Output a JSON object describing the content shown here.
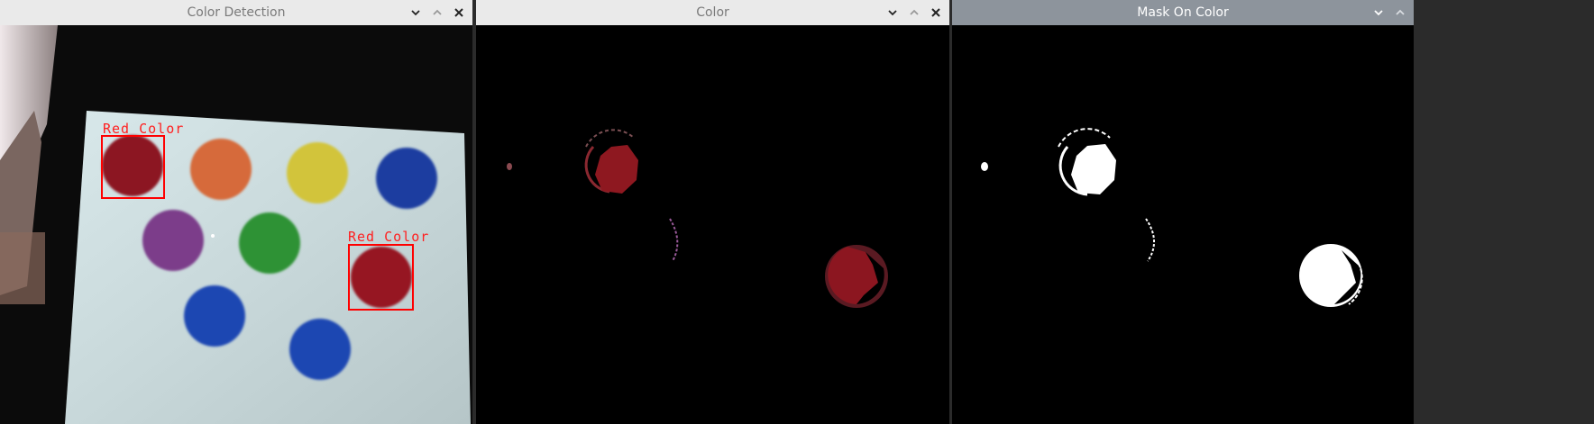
{
  "windows": [
    {
      "title": "Color Detection"
    },
    {
      "title": "Color"
    },
    {
      "title": "Mask On Color"
    }
  ],
  "detection": {
    "labels": [
      "Red Color",
      "Red Color"
    ]
  },
  "icons": {
    "minimize": "chevron-down-icon",
    "maximize": "chevron-up-icon",
    "close": "close-icon"
  },
  "colors": {
    "box": "#ff0000",
    "titlebar_light": "#eaeaea",
    "titlebar_dark": "#8d949c"
  }
}
